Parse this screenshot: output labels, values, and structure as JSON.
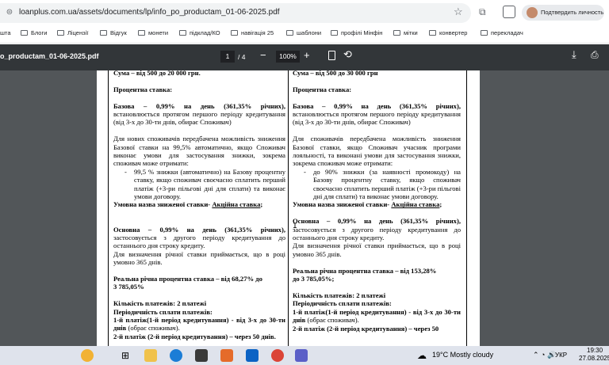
{
  "browser": {
    "url": "loanplus.com.ua/assets/documents/lp/info_po_productam_01-06-2025.pdf",
    "confirm_identity_label": "Подтвердить личность"
  },
  "bookmarks": [
    "шта",
    "Блоги",
    "Ліцензії",
    "Відгук",
    "монети",
    "підклад/КО",
    "навігація 25",
    "шаблони",
    "профілі Мінфін",
    "мітки",
    "конвертер",
    "перекладач"
  ],
  "pdf_toolbar": {
    "file_name": "o_productam_01-06-2025.pdf",
    "current_page": "1",
    "total_pages": "/ 4",
    "zoom": "100%"
  },
  "document": {
    "left": {
      "sum": "Сума – від 500 до 20 000 грн.",
      "rates_heading": "Процентна ставка:",
      "base_rate_bold": "Базова – 0,99% на день (361,35% річних),",
      "base_rate_text": "встановлюється протягом першого періоду кредитування (від 3-х до 30-ти днів, обирає Споживач)",
      "discount_intro": "Для нових споживачів передбачена можливість зниження Базової ставки на 99,5% автоматично, якщо Споживач виконає умови для застосування знижки, зокрема споживач може отримати:",
      "bullet": "99,5 % знижки (автоматично) на Базову процентну ставку, якщо споживач своєчасно сплатить перший платіж (+3-ри пільгові дні для сплати) та виконає умови договору.",
      "reduced_name_label": "Умовна назва зниженої ставки-",
      "reduced_name_value": "Акційна ставка",
      "main_rate_bold": "Основна – 0,99% на день (361,35% річних),",
      "main_rate_text": "застосовується з другого періоду кредитування до останнього дня строку кредиту.",
      "annual_note": "Для визначення річної ставки приймається, що в році умовно 365 днів.",
      "real_rate_1": "Реальна річна процентна ставка – від 68,27% до",
      "real_rate_2": "3 785,05%",
      "payments_count": "Кількість платежів: 2 платежі",
      "payments_period": "Періодичність сплати платежів:",
      "payment_1_bold": "1-й платіж(1-й період кредитування) - від 3-х до 30-ти днів",
      "payment_1_text": "(обрає споживач).",
      "payment_2": "2-й платіж (2-й період кредитування) – через 50 днів."
    },
    "right": {
      "sum": "Сума – від 500 до 30 000 грн",
      "rates_heading": "Процентна ставка:",
      "base_rate_bold": "Базова – 0,99% на день (361,35% річних),",
      "base_rate_text": "встановлюється протягом першого періоду кредитування (від 3-х до 30-ти днів, обирає Споживач)",
      "discount_intro": "Для споживачів передбачена можливість зниження Базової ставки, якщо Споживач учасник програми лояльності, та виконані умови для застосування знижки, зокрема споживач може отримати:",
      "bullet": "до 90% знижки (за наявності промокоду) на Базову процентну ставку, якщо споживач своєчасно сплатить перший платіж (+3-ри пільгові дні для сплати) та виконає умови договору.",
      "reduced_name_label": "Умовна назва зниженої ставки-",
      "reduced_name_value": "Акційна ставка",
      "main_rate_bold": "Основна – 0,99% на день (361,35% річних),",
      "main_rate_text": "застосовується з другого періоду кредитування до останнього дня строку кредиту.",
      "annual_note": "Для визначення річної ставки приймається, що в році умовно 365 днів.",
      "real_rate_1": "Реальна річна процентна ставка – від 153,28%",
      "real_rate_2": "до 3 785,05%;",
      "payments_count": "Кількість платежів: 2 платежі",
      "payments_period": "Періодичність сплати платежів:",
      "payment_1_bold": "1-й платіж(1-й період кредитування) - від 3-х до 30-ти днів",
      "payment_1_text": "(обрає споживач).",
      "payment_2": "2-й платіж (2-й період кредитування) – через 50"
    }
  },
  "taskbar": {
    "weather": "19°C  Mostly cloudy",
    "language": "УКР",
    "time": "19:30",
    "date": "27.08.2025"
  },
  "colors": {
    "pdf_toolbar": "#323639",
    "viewer_background": "#525659",
    "taskbar": "#dfe3ec"
  }
}
